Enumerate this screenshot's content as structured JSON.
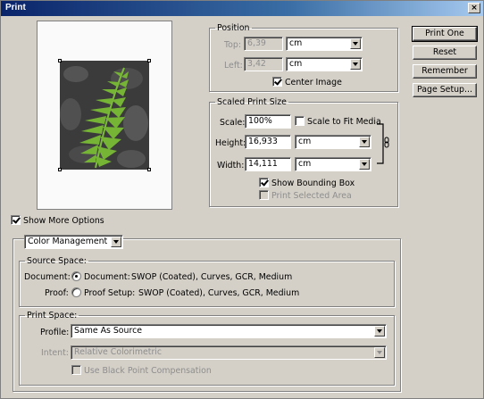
{
  "window": {
    "title": "Print",
    "close_glyph": "×"
  },
  "preview": {
    "image_icon": "fern-photo-icon"
  },
  "position": {
    "legend": "Position",
    "top_label": "Top:",
    "top_value": "6,39",
    "top_unit": "cm",
    "left_label": "Left:",
    "left_value": "3,42",
    "left_unit": "cm",
    "center_image_label": "Center Image",
    "center_image_checked": true
  },
  "scaled": {
    "legend": "Scaled Print Size",
    "scale_label": "Scale:",
    "scale_value": "100%",
    "scale_to_fit_label": "Scale to Fit Media",
    "scale_to_fit_checked": false,
    "height_label": "Height:",
    "height_value": "16,933",
    "height_unit": "cm",
    "width_label": "Width:",
    "width_value": "14,111",
    "width_unit": "cm",
    "bounding_box_label": "Show Bounding Box",
    "bounding_box_checked": true,
    "print_selected_label": "Print Selected Area",
    "print_selected_checked": false,
    "link_icon": "chain-link-icon"
  },
  "buttons": {
    "print_one": "Print One",
    "reset": "Reset",
    "remember": "Remember",
    "page_setup": "Page Setup..."
  },
  "more_options": {
    "label": "Show More Options",
    "checked": true
  },
  "color_management": {
    "dropdown": "Color Management",
    "source_legend": "Source Space:",
    "document_label": "Document:",
    "document_radio_label": "Document:",
    "document_value": "SWOP (Coated), Curves, GCR, Medium",
    "proof_label": "Proof:",
    "proof_radio_label": "Proof Setup:",
    "proof_value": "SWOP (Coated), Curves, GCR, Medium",
    "print_legend": "Print Space:",
    "profile_label": "Profile:",
    "profile_value": "Same As Source",
    "intent_label": "Intent:",
    "intent_value": "Relative Colorimetric",
    "bpc_label": "Use Black Point Compensation",
    "bpc_checked": false
  }
}
